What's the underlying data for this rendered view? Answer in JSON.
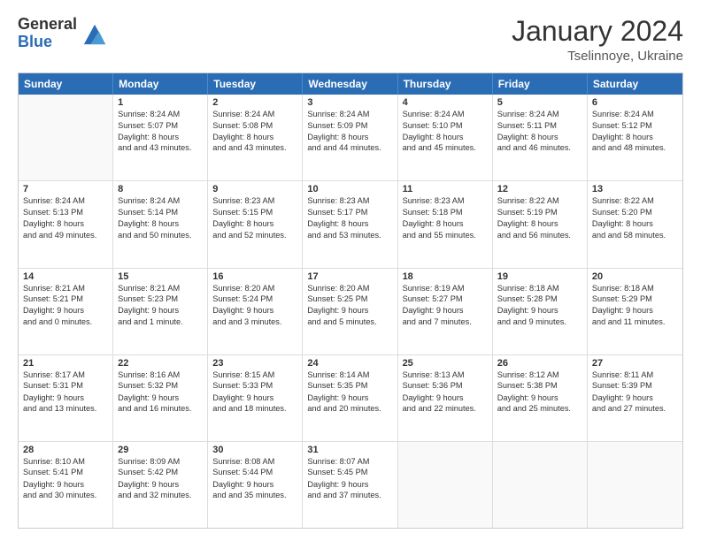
{
  "logo": {
    "general": "General",
    "blue": "Blue"
  },
  "header": {
    "month_year": "January 2024",
    "location": "Tselinnoye, Ukraine"
  },
  "weekdays": [
    "Sunday",
    "Monday",
    "Tuesday",
    "Wednesday",
    "Thursday",
    "Friday",
    "Saturday"
  ],
  "rows": [
    [
      {
        "day": "",
        "empty": true
      },
      {
        "day": "1",
        "sunrise": "Sunrise: 8:24 AM",
        "sunset": "Sunset: 5:07 PM",
        "daylight": "Daylight: 8 hours and 43 minutes."
      },
      {
        "day": "2",
        "sunrise": "Sunrise: 8:24 AM",
        "sunset": "Sunset: 5:08 PM",
        "daylight": "Daylight: 8 hours and 43 minutes."
      },
      {
        "day": "3",
        "sunrise": "Sunrise: 8:24 AM",
        "sunset": "Sunset: 5:09 PM",
        "daylight": "Daylight: 8 hours and 44 minutes."
      },
      {
        "day": "4",
        "sunrise": "Sunrise: 8:24 AM",
        "sunset": "Sunset: 5:10 PM",
        "daylight": "Daylight: 8 hours and 45 minutes."
      },
      {
        "day": "5",
        "sunrise": "Sunrise: 8:24 AM",
        "sunset": "Sunset: 5:11 PM",
        "daylight": "Daylight: 8 hours and 46 minutes."
      },
      {
        "day": "6",
        "sunrise": "Sunrise: 8:24 AM",
        "sunset": "Sunset: 5:12 PM",
        "daylight": "Daylight: 8 hours and 48 minutes."
      }
    ],
    [
      {
        "day": "7",
        "sunrise": "Sunrise: 8:24 AM",
        "sunset": "Sunset: 5:13 PM",
        "daylight": "Daylight: 8 hours and 49 minutes."
      },
      {
        "day": "8",
        "sunrise": "Sunrise: 8:24 AM",
        "sunset": "Sunset: 5:14 PM",
        "daylight": "Daylight: 8 hours and 50 minutes."
      },
      {
        "day": "9",
        "sunrise": "Sunrise: 8:23 AM",
        "sunset": "Sunset: 5:15 PM",
        "daylight": "Daylight: 8 hours and 52 minutes."
      },
      {
        "day": "10",
        "sunrise": "Sunrise: 8:23 AM",
        "sunset": "Sunset: 5:17 PM",
        "daylight": "Daylight: 8 hours and 53 minutes."
      },
      {
        "day": "11",
        "sunrise": "Sunrise: 8:23 AM",
        "sunset": "Sunset: 5:18 PM",
        "daylight": "Daylight: 8 hours and 55 minutes."
      },
      {
        "day": "12",
        "sunrise": "Sunrise: 8:22 AM",
        "sunset": "Sunset: 5:19 PM",
        "daylight": "Daylight: 8 hours and 56 minutes."
      },
      {
        "day": "13",
        "sunrise": "Sunrise: 8:22 AM",
        "sunset": "Sunset: 5:20 PM",
        "daylight": "Daylight: 8 hours and 58 minutes."
      }
    ],
    [
      {
        "day": "14",
        "sunrise": "Sunrise: 8:21 AM",
        "sunset": "Sunset: 5:21 PM",
        "daylight": "Daylight: 9 hours and 0 minutes."
      },
      {
        "day": "15",
        "sunrise": "Sunrise: 8:21 AM",
        "sunset": "Sunset: 5:23 PM",
        "daylight": "Daylight: 9 hours and 1 minute."
      },
      {
        "day": "16",
        "sunrise": "Sunrise: 8:20 AM",
        "sunset": "Sunset: 5:24 PM",
        "daylight": "Daylight: 9 hours and 3 minutes."
      },
      {
        "day": "17",
        "sunrise": "Sunrise: 8:20 AM",
        "sunset": "Sunset: 5:25 PM",
        "daylight": "Daylight: 9 hours and 5 minutes."
      },
      {
        "day": "18",
        "sunrise": "Sunrise: 8:19 AM",
        "sunset": "Sunset: 5:27 PM",
        "daylight": "Daylight: 9 hours and 7 minutes."
      },
      {
        "day": "19",
        "sunrise": "Sunrise: 8:18 AM",
        "sunset": "Sunset: 5:28 PM",
        "daylight": "Daylight: 9 hours and 9 minutes."
      },
      {
        "day": "20",
        "sunrise": "Sunrise: 8:18 AM",
        "sunset": "Sunset: 5:29 PM",
        "daylight": "Daylight: 9 hours and 11 minutes."
      }
    ],
    [
      {
        "day": "21",
        "sunrise": "Sunrise: 8:17 AM",
        "sunset": "Sunset: 5:31 PM",
        "daylight": "Daylight: 9 hours and 13 minutes."
      },
      {
        "day": "22",
        "sunrise": "Sunrise: 8:16 AM",
        "sunset": "Sunset: 5:32 PM",
        "daylight": "Daylight: 9 hours and 16 minutes."
      },
      {
        "day": "23",
        "sunrise": "Sunrise: 8:15 AM",
        "sunset": "Sunset: 5:33 PM",
        "daylight": "Daylight: 9 hours and 18 minutes."
      },
      {
        "day": "24",
        "sunrise": "Sunrise: 8:14 AM",
        "sunset": "Sunset: 5:35 PM",
        "daylight": "Daylight: 9 hours and 20 minutes."
      },
      {
        "day": "25",
        "sunrise": "Sunrise: 8:13 AM",
        "sunset": "Sunset: 5:36 PM",
        "daylight": "Daylight: 9 hours and 22 minutes."
      },
      {
        "day": "26",
        "sunrise": "Sunrise: 8:12 AM",
        "sunset": "Sunset: 5:38 PM",
        "daylight": "Daylight: 9 hours and 25 minutes."
      },
      {
        "day": "27",
        "sunrise": "Sunrise: 8:11 AM",
        "sunset": "Sunset: 5:39 PM",
        "daylight": "Daylight: 9 hours and 27 minutes."
      }
    ],
    [
      {
        "day": "28",
        "sunrise": "Sunrise: 8:10 AM",
        "sunset": "Sunset: 5:41 PM",
        "daylight": "Daylight: 9 hours and 30 minutes."
      },
      {
        "day": "29",
        "sunrise": "Sunrise: 8:09 AM",
        "sunset": "Sunset: 5:42 PM",
        "daylight": "Daylight: 9 hours and 32 minutes."
      },
      {
        "day": "30",
        "sunrise": "Sunrise: 8:08 AM",
        "sunset": "Sunset: 5:44 PM",
        "daylight": "Daylight: 9 hours and 35 minutes."
      },
      {
        "day": "31",
        "sunrise": "Sunrise: 8:07 AM",
        "sunset": "Sunset: 5:45 PM",
        "daylight": "Daylight: 9 hours and 37 minutes."
      },
      {
        "day": "",
        "empty": true
      },
      {
        "day": "",
        "empty": true
      },
      {
        "day": "",
        "empty": true
      }
    ]
  ]
}
